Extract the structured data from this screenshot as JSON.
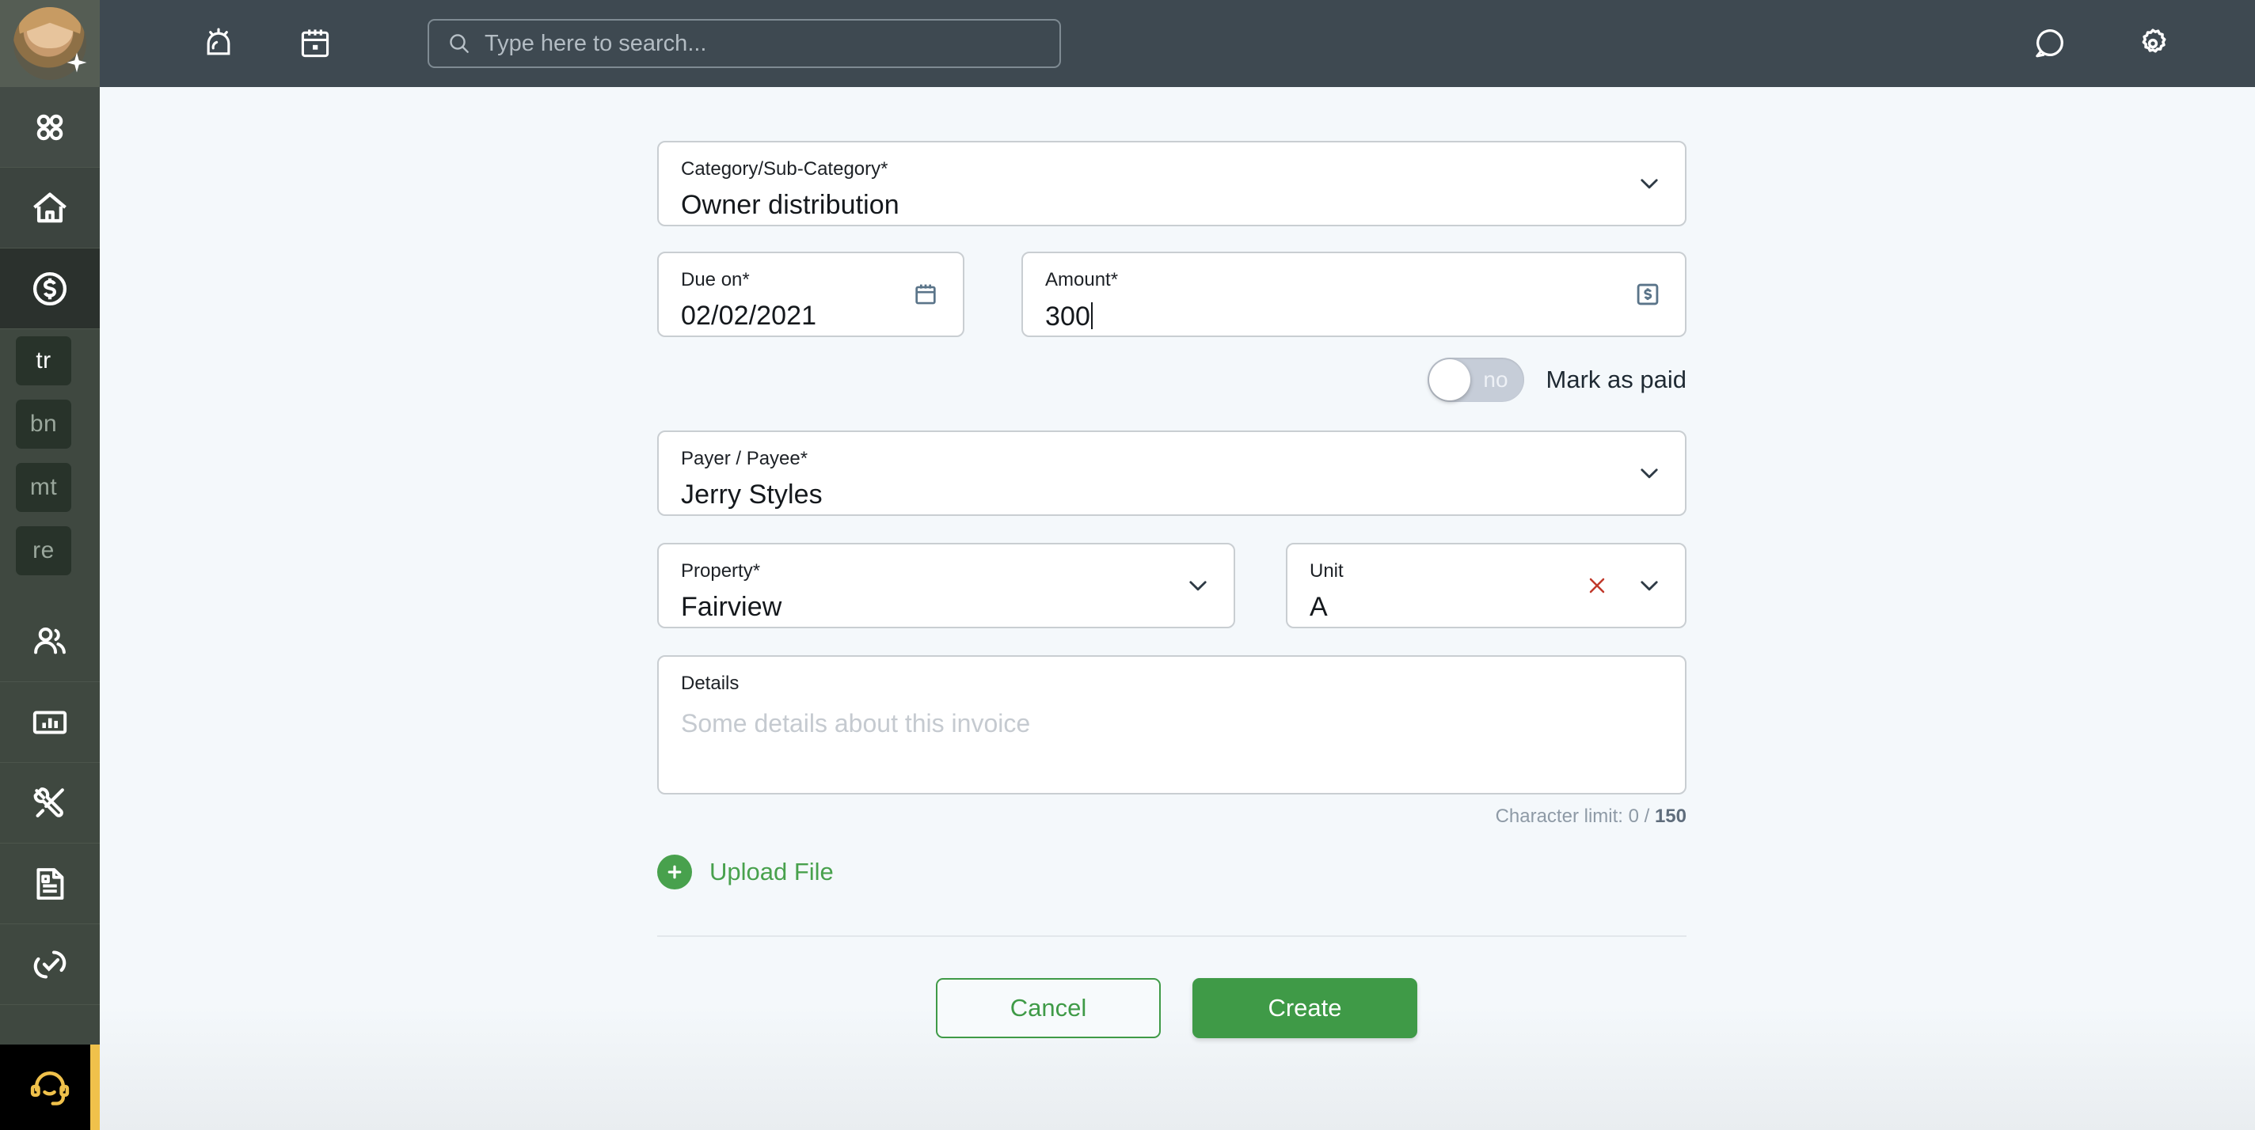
{
  "topbar": {
    "avatar_name": "user-avatar",
    "alarm_icon": "alarm-icon",
    "calendar_icon": "calendar-icon",
    "search_placeholder": "Type here to search...",
    "search_value": "",
    "chat_icon": "chat-bubble-icon",
    "settings_icon": "gear-icon"
  },
  "sidebar": {
    "items": [
      {
        "icon": "grid-apps-icon",
        "label": ""
      },
      {
        "icon": "home-icon",
        "label": ""
      },
      {
        "icon": "dollar-circle-icon",
        "label": "",
        "active": true
      }
    ],
    "chips": [
      {
        "label": "tr",
        "active": true
      },
      {
        "label": "bn",
        "active": false
      },
      {
        "label": "mt",
        "active": false
      },
      {
        "label": "re",
        "active": false
      }
    ],
    "lower_items": [
      {
        "icon": "people-icon"
      },
      {
        "icon": "bar-chart-icon"
      },
      {
        "icon": "tools-icon"
      },
      {
        "icon": "document-icon"
      },
      {
        "icon": "link-icon"
      }
    ],
    "support_icon": "headset-icon"
  },
  "form": {
    "category": {
      "label": "Category/Sub-Category*",
      "value": "Owner distribution",
      "icon": "chevron-down-icon"
    },
    "due_on": {
      "label": "Due on*",
      "value": "02/02/2021",
      "icon": "calendar-icon"
    },
    "amount": {
      "label": "Amount*",
      "value": "300",
      "icon": "dollar-square-icon"
    },
    "mark_as_paid": {
      "toggle_state": "no",
      "label": "Mark as paid"
    },
    "payer": {
      "label": "Payer / Payee*",
      "value": "Jerry Styles",
      "icon": "chevron-down-icon"
    },
    "property": {
      "label": "Property*",
      "value": "Fairview",
      "icon": "chevron-down-icon"
    },
    "unit": {
      "label": "Unit",
      "value": "A",
      "clear_icon": "close-x-icon",
      "icon": "chevron-down-icon"
    },
    "details": {
      "label": "Details",
      "placeholder": "Some details about this invoice",
      "value": ""
    },
    "character_limit": {
      "prefix": "Character limit: 0 / ",
      "max": "150"
    },
    "upload": {
      "label": "Upload File",
      "icon": "plus-circle-icon"
    },
    "cancel_label": "Cancel",
    "create_label": "Create"
  },
  "colors": {
    "topbar_bg": "#3e4951",
    "sidebar_bg": "#3f4840",
    "accent_green": "#3f9a47",
    "support_yellow": "#f0c14b",
    "clear_red": "#c0392b"
  }
}
